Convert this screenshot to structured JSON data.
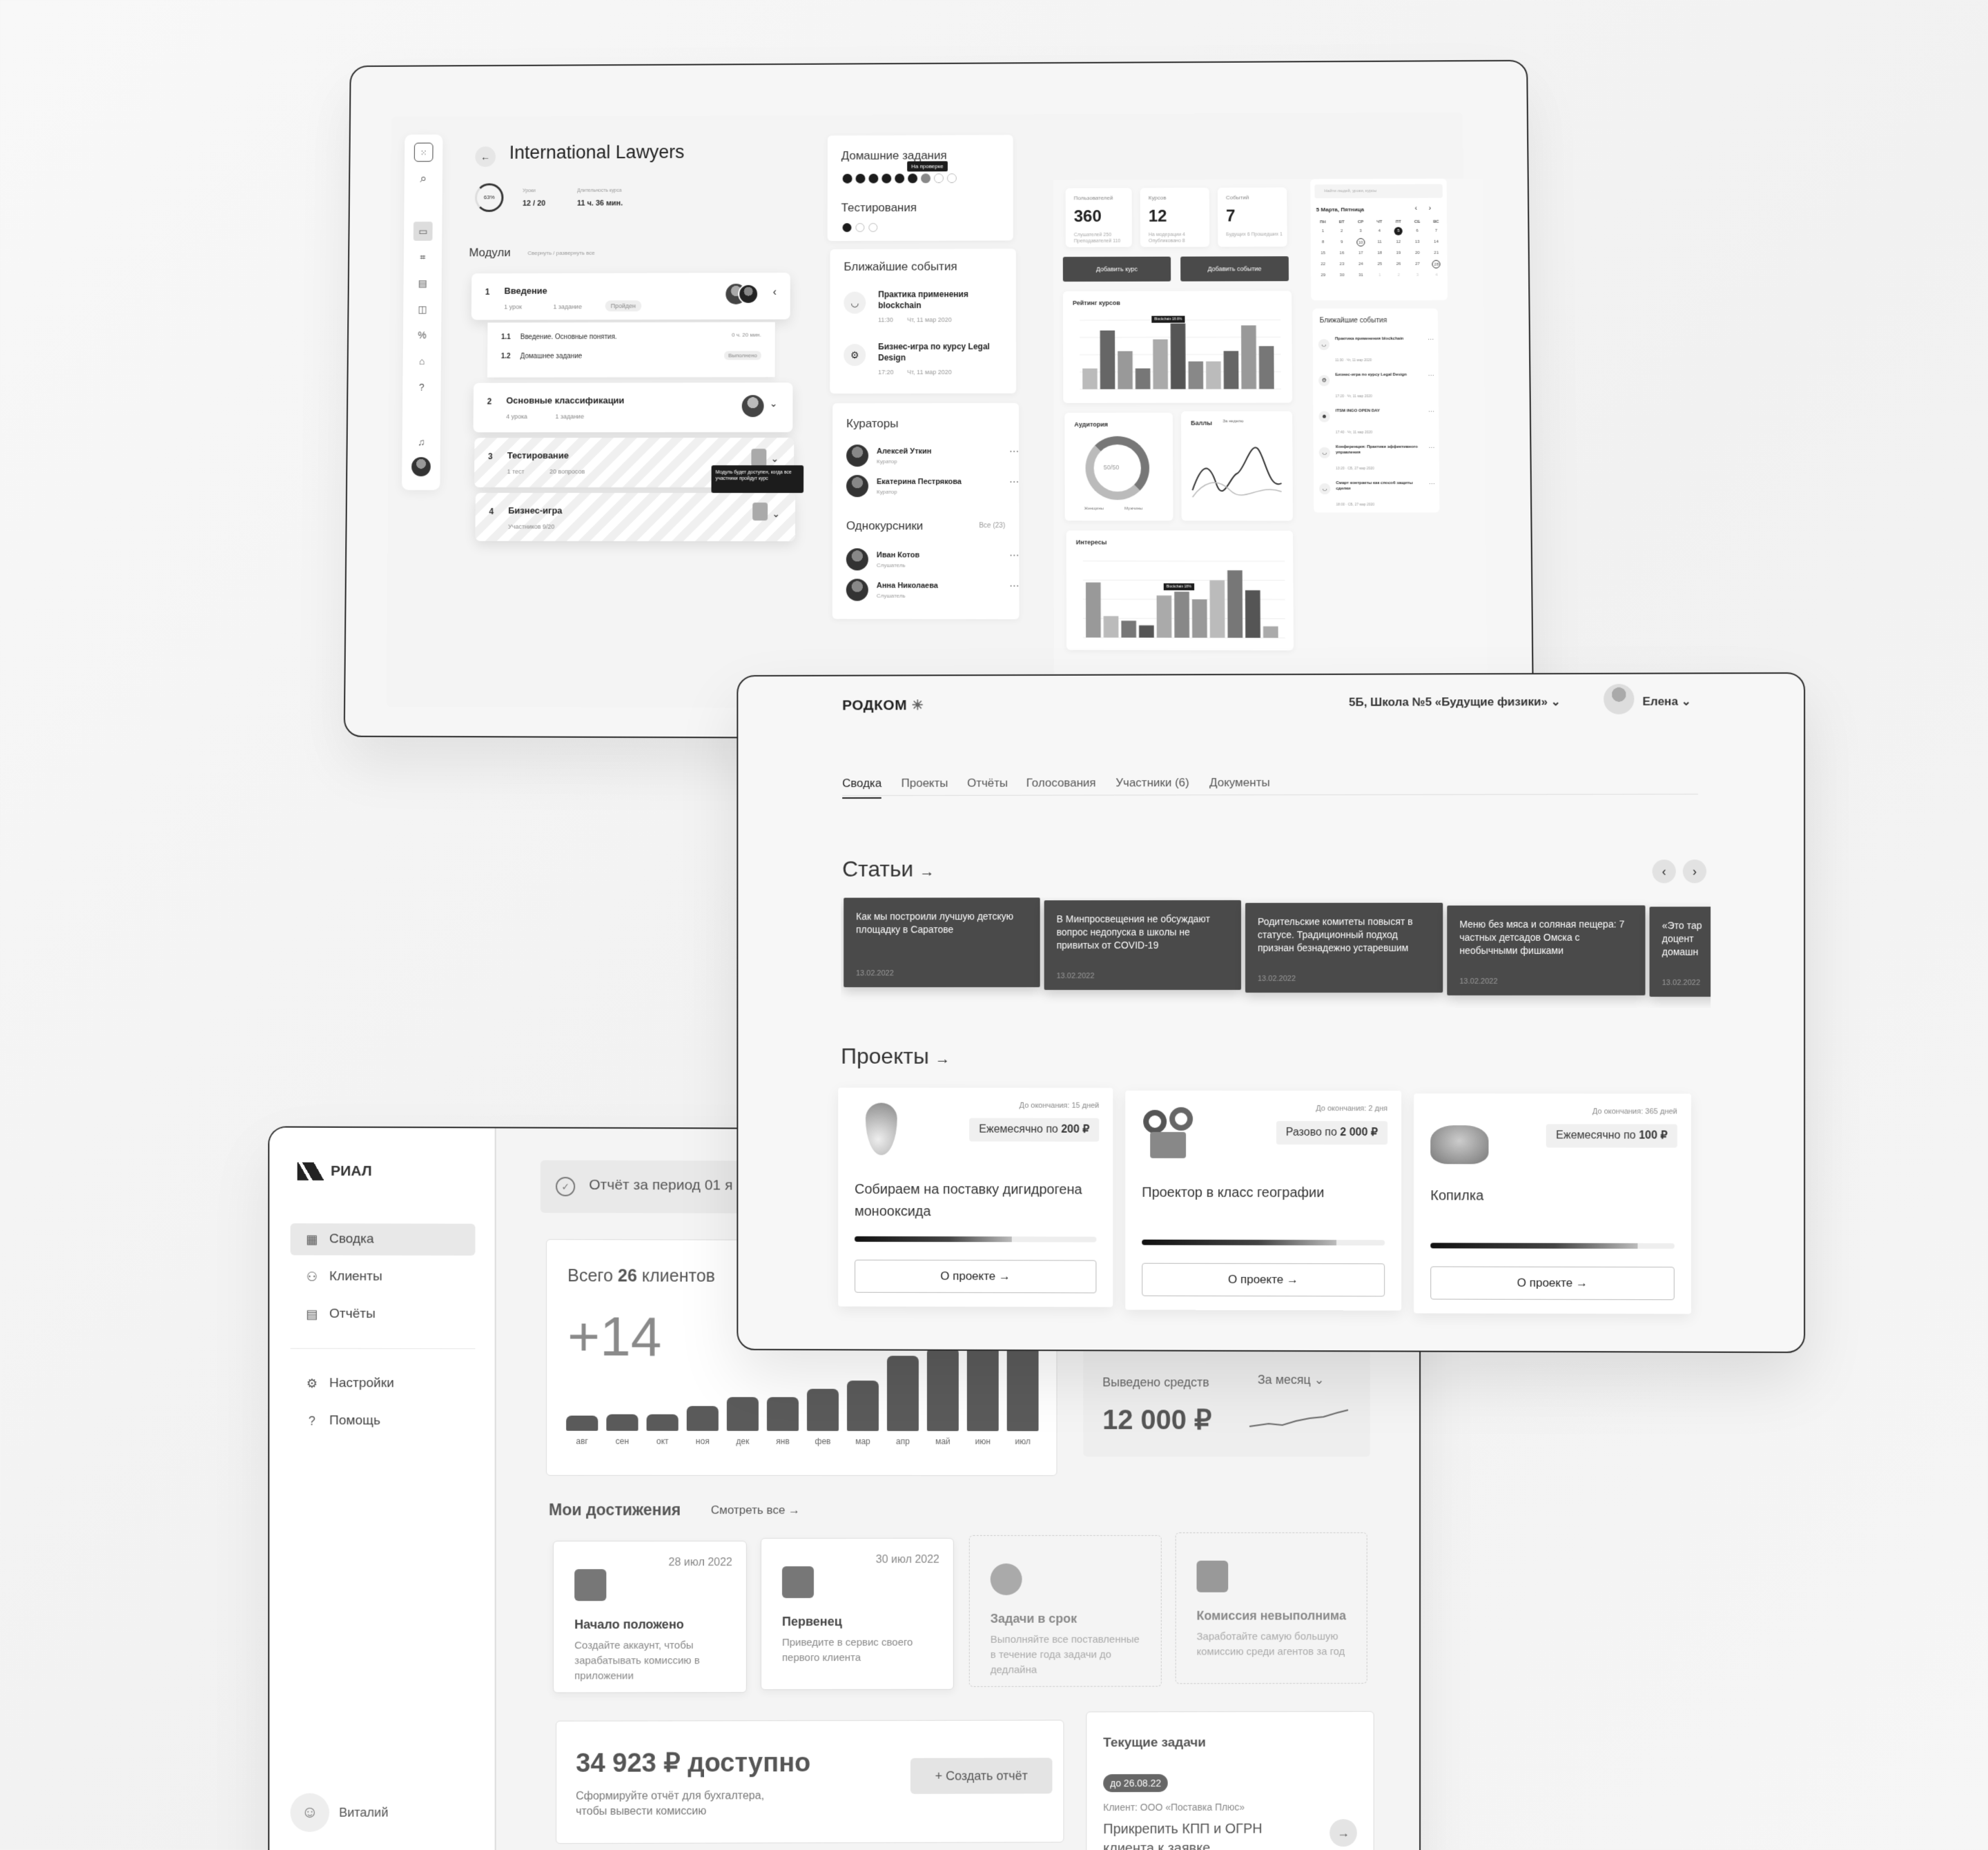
{
  "course": {
    "title": "International Lawyers",
    "progress_pct": "63%",
    "lessons_label": "Уроки",
    "lessons_value": "12 / 20",
    "duration_label": "Длительность курса",
    "duration_value": "11 ч. 36 мин.",
    "modules_title": "Модули",
    "modules_toggle": "Свернуть / развернуть все",
    "modules": [
      {
        "num": "1",
        "name": "Введение",
        "meta1": "1 урок",
        "meta2": "1 задание",
        "status": "Пройден"
      },
      {
        "num": "2",
        "name": "Основные классификации",
        "meta1": "4 урока",
        "meta2": "1 задание"
      },
      {
        "num": "3",
        "name": "Тестирование",
        "meta1": "1 тест",
        "meta2": "20 вопросов"
      },
      {
        "num": "4",
        "name": "Бизнес-игра",
        "meta1": "Участников 9/20"
      }
    ],
    "sub_items": [
      {
        "num": "1.1",
        "name": "Введение. Основные понятия.",
        "meta": "0 ч. 20 мин."
      },
      {
        "num": "1.2",
        "name": "Домашнее задание",
        "meta": "Выполнено"
      }
    ],
    "locked_tooltip": "Модуль будет доступен, когда все участники пройдут курс",
    "homework_title": "Домашние задания",
    "homework_tooltip": "На проверке",
    "testing_title": "Тестирования",
    "events_title": "Ближайшие события",
    "events": [
      {
        "name": "Практика применения blockchain",
        "time": "11:30",
        "date": "Чт, 11 мар 2020"
      },
      {
        "name": "Бизнес-игра по курсу Legal Design",
        "time": "17:20",
        "date": "Чт, 11 мар 2020"
      }
    ],
    "curators_title": "Кураторы",
    "curators": [
      {
        "name": "Алексей Уткин",
        "role": "Куратор"
      },
      {
        "name": "Екатерина Пестрякова",
        "role": "Куратор"
      }
    ],
    "classmates_title": "Однокурсники",
    "classmates_all": "Все (23)",
    "classmates": [
      {
        "name": "Иван Котов",
        "role": "Слушатель"
      },
      {
        "name": "Анна Николаева",
        "role": "Слушатель"
      }
    ]
  },
  "dashboard": {
    "stats": [
      {
        "label": "Пользователей",
        "value": "360",
        "sub": "Слушателей 250 Преподавателей 110"
      },
      {
        "label": "Курсов",
        "value": "12",
        "sub": "На модерации 4 Опубликовано 8"
      },
      {
        "label": "Событий",
        "value": "7",
        "sub": "Будущих 6 Прошедших 1"
      }
    ],
    "btn_add_course": "Добавить курс",
    "btn_add_event": "Добавить событие",
    "rating_title": "Рейтинг курсов",
    "rating_tooltip": "Blockchain 18.6%",
    "audience_title": "Аудитория",
    "audience_center": "50/50",
    "audience_legend": [
      "Женщины",
      "Мужчины"
    ],
    "scores_title": "Баллы",
    "scores_filter": "За неделю",
    "interests_title": "Интересы",
    "interests_tooltip": "Blockchain 18%",
    "search_placeholder": "Найти людей, уроки, курсы",
    "calendar_title": "5 Марта, Пятница",
    "weekdays": [
      "ПН",
      "ВТ",
      "СР",
      "ЧТ",
      "ПТ",
      "СБ",
      "ВС"
    ],
    "cal_days": [
      "1",
      "2",
      "3",
      "4",
      "5",
      "6",
      "7",
      "8",
      "9",
      "10",
      "11",
      "12",
      "13",
      "14",
      "15",
      "16",
      "17",
      "18",
      "19",
      "20",
      "21",
      "22",
      "23",
      "24",
      "25",
      "26",
      "27",
      "28",
      "29",
      "30",
      "31",
      "1",
      "2",
      "3",
      "4"
    ],
    "events_title": "Ближайшие события",
    "events": [
      {
        "name": "Практика применения blockchain",
        "date": "11:30 · Чт, 11 мар 2020"
      },
      {
        "name": "Бизнес-игра по курсу Legal Design",
        "date": "17:20 · Чт, 11 мар 2020"
      },
      {
        "name": "ITSM INGO OPEN DAY",
        "date": "17:40 · Чт, 11 мар 2020"
      },
      {
        "name": "Конференция: Практики эффективного управления",
        "date": "13:20 · СБ, 27 мар 2020"
      },
      {
        "name": "Смарт контракты как способ защиты сделки",
        "date": "18:00 · СБ, 27 мар 2020"
      }
    ]
  },
  "rodkom": {
    "logo": "РОДКОМ",
    "school": "5Б, Школа №5 «Будущие физики»",
    "user": "Елена",
    "tabs": [
      "Сводка",
      "Проекты",
      "Отчёты",
      "Голосования",
      "Участники (6)",
      "Документы"
    ],
    "articles_title": "Статьи",
    "articles": [
      {
        "text": "Как мы построили лучшую детскую площадку в Саратове",
        "date": "13.02.2022"
      },
      {
        "text": "В Минпросвещения не обсуждают вопрос недопуска в школы не привитых от COVID-19",
        "date": "13.02.2022"
      },
      {
        "text": "Родительские комитеты повысят в статусе. Традиционный подход признан безнадежно устаревшим",
        "date": "13.02.2022"
      },
      {
        "text": "Меню без мяса и соляная пещера: 7 частных детсадов Омска с необычными фишками",
        "date": "13.02.2022"
      },
      {
        "text": "«Это тар доцент домашн",
        "date": "13.02.2022"
      }
    ],
    "projects_title": "Проекты",
    "projects": [
      {
        "deadline": "До окончания: 15 дней",
        "pill_pre": "Ежемесячно по ",
        "pill_amt": "200 ₽",
        "title": "Собираем на поставку дигидрогена монооксида",
        "progress": 0.65,
        "btn": "О проекте"
      },
      {
        "deadline": "До окончания: 2 дня",
        "pill_pre": "Разово по ",
        "pill_amt": "2 000 ₽",
        "title": "Проектор в класс географии",
        "progress": 0.8,
        "btn": "О проекте"
      },
      {
        "deadline": "До окончания: 365 дней",
        "pill_pre": "Ежемесячно по ",
        "pill_amt": "100 ₽",
        "title": "Копилка",
        "progress": 0.85,
        "btn": "О проекте"
      }
    ]
  },
  "rial": {
    "logo": "РИАЛ",
    "nav": [
      "Сводка",
      "Клиенты",
      "Отчёты",
      "Настройки",
      "Помощь"
    ],
    "user": "Виталий",
    "report_banner": "Отчёт за период 01 я",
    "clients_pre": "Всего ",
    "clients_num": "26",
    "clients_post": " клиентов",
    "clients_delta": "+14",
    "chart_data": {
      "type": "bar",
      "categories": [
        "авг",
        "сен",
        "окт",
        "ноя",
        "дек",
        "янв",
        "фев",
        "мар",
        "апр",
        "май",
        "июн",
        "июл"
      ],
      "values": [
        1,
        2,
        2,
        3,
        4,
        4,
        5,
        6,
        9,
        10,
        12,
        14
      ]
    },
    "withdrawn_label": "Выведено средств",
    "withdrawn_period": "За месяц",
    "withdrawn_value": "12 000 ₽",
    "achievements_title": "Мои достижения",
    "achievements_all": "Смотреть все",
    "achievements": [
      {
        "date": "28 июл 2022",
        "title": "Начало положено",
        "desc": "Создайте аккаунт, чтобы зарабатывать комиссию в приложении"
      },
      {
        "date": "30 июл 2022",
        "title": "Первенец",
        "desc": "Приведите в сервис своего первого клиента"
      },
      {
        "date": "",
        "title": "Задачи в срок",
        "desc": "Выполняйте все поставленные в течение года задачи до дедлайна"
      },
      {
        "date": "",
        "title": "Комиссия невыполнима",
        "desc": "Заработайте самую большую комиссию среди агентов за год"
      }
    ],
    "available_value": "34 923 ₽ доступно",
    "available_desc": "Сформируйте отчёт для бухгалтера, чтобы вывести комиссию",
    "create_report": "Создать отчёт",
    "tasks_title": "Текущие задачи",
    "task_due": "до 26.08.22",
    "task_client": "Клиент: ООО «Поставка Плюс»",
    "task_text": "Прикрепить КПП и ОГРН клиента к заявке"
  }
}
